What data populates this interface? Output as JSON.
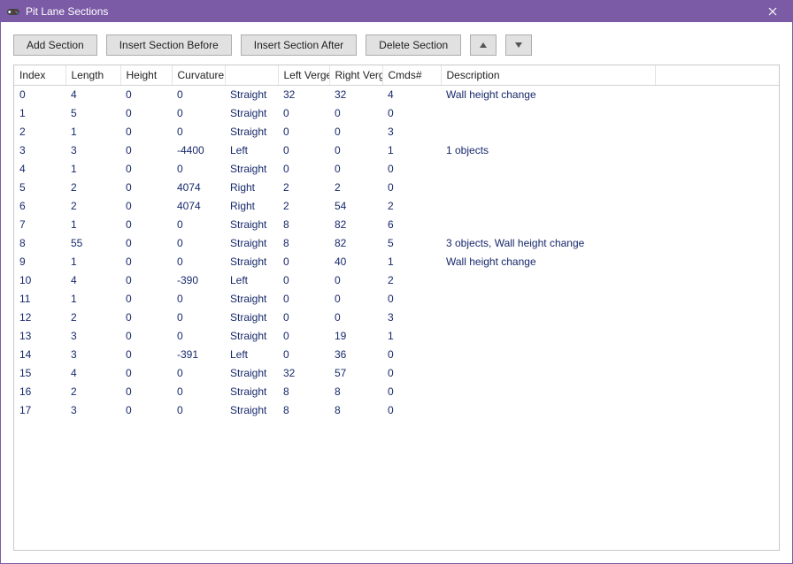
{
  "window": {
    "title": "Pit Lane Sections",
    "icon": "gamepad-icon"
  },
  "toolbar": {
    "add_label": "Add Section",
    "insert_before_label": "Insert Section Before",
    "insert_after_label": "Insert Section After",
    "delete_label": "Delete Section",
    "move_up_icon": "triangle-up-icon",
    "move_down_icon": "triangle-down-icon"
  },
  "columns": {
    "index": "Index",
    "length": "Length",
    "height": "Height",
    "curvature": "Curvature",
    "direction": "",
    "left_verge": "Left Verge",
    "right_verge": "Right Verge",
    "cmds": "Cmds#",
    "description": "Description",
    "extra": ""
  },
  "rows": [
    {
      "index": "0",
      "length": "4",
      "height": "0",
      "curvature": "0",
      "direction": "Straight",
      "left_verge": "32",
      "right_verge": "32",
      "cmds": "4",
      "description": "Wall height change"
    },
    {
      "index": "1",
      "length": "5",
      "height": "0",
      "curvature": "0",
      "direction": "Straight",
      "left_verge": "0",
      "right_verge": "0",
      "cmds": "0",
      "description": ""
    },
    {
      "index": "2",
      "length": "1",
      "height": "0",
      "curvature": "0",
      "direction": "Straight",
      "left_verge": "0",
      "right_verge": "0",
      "cmds": "3",
      "description": ""
    },
    {
      "index": "3",
      "length": "3",
      "height": "0",
      "curvature": "-4400",
      "direction": "Left",
      "left_verge": "0",
      "right_verge": "0",
      "cmds": "1",
      "description": "1 objects"
    },
    {
      "index": "4",
      "length": "1",
      "height": "0",
      "curvature": "0",
      "direction": "Straight",
      "left_verge": "0",
      "right_verge": "0",
      "cmds": "0",
      "description": ""
    },
    {
      "index": "5",
      "length": "2",
      "height": "0",
      "curvature": "4074",
      "direction": "Right",
      "left_verge": "2",
      "right_verge": "2",
      "cmds": "0",
      "description": ""
    },
    {
      "index": "6",
      "length": "2",
      "height": "0",
      "curvature": "4074",
      "direction": "Right",
      "left_verge": "2",
      "right_verge": "54",
      "cmds": "2",
      "description": ""
    },
    {
      "index": "7",
      "length": "1",
      "height": "0",
      "curvature": "0",
      "direction": "Straight",
      "left_verge": "8",
      "right_verge": "82",
      "cmds": "6",
      "description": ""
    },
    {
      "index": "8",
      "length": "55",
      "height": "0",
      "curvature": "0",
      "direction": "Straight",
      "left_verge": "8",
      "right_verge": "82",
      "cmds": "5",
      "description": "3 objects, Wall height change"
    },
    {
      "index": "9",
      "length": "1",
      "height": "0",
      "curvature": "0",
      "direction": "Straight",
      "left_verge": "0",
      "right_verge": "40",
      "cmds": "1",
      "description": "Wall height change"
    },
    {
      "index": "10",
      "length": "4",
      "height": "0",
      "curvature": "-390",
      "direction": "Left",
      "left_verge": "0",
      "right_verge": "0",
      "cmds": "2",
      "description": ""
    },
    {
      "index": "11",
      "length": "1",
      "height": "0",
      "curvature": "0",
      "direction": "Straight",
      "left_verge": "0",
      "right_verge": "0",
      "cmds": "0",
      "description": ""
    },
    {
      "index": "12",
      "length": "2",
      "height": "0",
      "curvature": "0",
      "direction": "Straight",
      "left_verge": "0",
      "right_verge": "0",
      "cmds": "3",
      "description": ""
    },
    {
      "index": "13",
      "length": "3",
      "height": "0",
      "curvature": "0",
      "direction": "Straight",
      "left_verge": "0",
      "right_verge": "19",
      "cmds": "1",
      "description": ""
    },
    {
      "index": "14",
      "length": "3",
      "height": "0",
      "curvature": "-391",
      "direction": "Left",
      "left_verge": "0",
      "right_verge": "36",
      "cmds": "0",
      "description": ""
    },
    {
      "index": "15",
      "length": "4",
      "height": "0",
      "curvature": "0",
      "direction": "Straight",
      "left_verge": "32",
      "right_verge": "57",
      "cmds": "0",
      "description": ""
    },
    {
      "index": "16",
      "length": "2",
      "height": "0",
      "curvature": "0",
      "direction": "Straight",
      "left_verge": "8",
      "right_verge": "8",
      "cmds": "0",
      "description": ""
    },
    {
      "index": "17",
      "length": "3",
      "height": "0",
      "curvature": "0",
      "direction": "Straight",
      "left_verge": "8",
      "right_verge": "8",
      "cmds": "0",
      "description": ""
    }
  ],
  "colors": {
    "accent": "#7c5ba6",
    "cell_text": "#17296b"
  }
}
